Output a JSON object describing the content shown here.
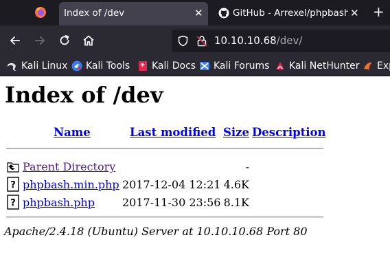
{
  "browser": {
    "tabs": [
      {
        "title": "Index of /dev",
        "active": true
      },
      {
        "title": "GitHub - Arrexel/phpbash",
        "active": false
      }
    ],
    "address": {
      "host": "10.10.10.68",
      "path": "/dev/"
    },
    "bookmarks": [
      {
        "label": "Kali Linux",
        "icon": "kali-dragon-icon"
      },
      {
        "label": "Kali Tools",
        "icon": "kali-tools-icon"
      },
      {
        "label": "Kali Docs",
        "icon": "kali-docs-icon"
      },
      {
        "label": "Kali Forums",
        "icon": "kali-forums-icon"
      },
      {
        "label": "Kali NetHunter",
        "icon": "kali-nethunter-icon"
      },
      {
        "label": "Exp",
        "icon": "exploit-db-icon"
      }
    ]
  },
  "page": {
    "title": "Index of /dev",
    "columns": {
      "name": "Name",
      "modified": "Last modified",
      "size": "Size",
      "description": "Description"
    },
    "rows": [
      {
        "name": "Parent Directory",
        "modified": "",
        "size": "-",
        "icon": "parent-directory-icon",
        "visited": true
      },
      {
        "name": "phpbash.min.php",
        "modified": "2017-12-04 12:21",
        "size": "4.6K",
        "icon": "unknown-file-icon",
        "visited": false
      },
      {
        "name": "phpbash.php",
        "modified": "2017-11-30 23:56",
        "size": "8.1K",
        "icon": "unknown-file-icon",
        "visited": false
      }
    ],
    "server_signature": "Apache/2.4.18 (Ubuntu) Server at 10.10.10.68 Port 80"
  },
  "colors": {
    "link": "#0000ee",
    "visited": "#551a8b",
    "chrome_dark": "#1c1b22",
    "chrome": "#2b2a33"
  }
}
